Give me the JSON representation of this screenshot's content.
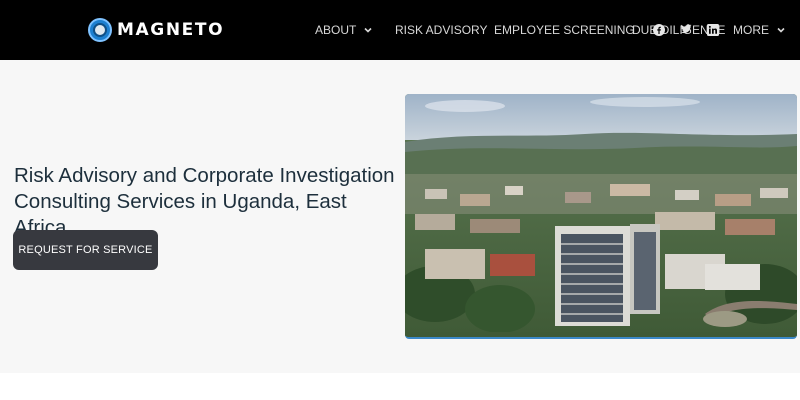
{
  "brand": {
    "name": "MAGNETO",
    "logo_icon": "globe-logo-icon"
  },
  "nav": {
    "items": [
      {
        "label": "ABOUT",
        "dropdown": true
      },
      {
        "label": "RISK ADVISORY",
        "dropdown": false
      },
      {
        "label": "EMPLOYEE SCREENING",
        "dropdown": false
      },
      {
        "label": "DUE DILIGENCE",
        "dropdown": false
      },
      {
        "label": "MORE",
        "dropdown": true
      }
    ],
    "social_icons": [
      "facebook-icon",
      "twitter-icon",
      "linkedin-icon"
    ]
  },
  "hero": {
    "title_line1": "Risk Advisory and Corporate Investigation",
    "title_line2": "Consulting Services in Uganda, East Africa.",
    "cta_label": "REQUEST FOR SERVICE"
  },
  "colors": {
    "navbar_bg": "#000000",
    "hero_bg": "#f7f7f7",
    "title_text": "#1d2f3c",
    "cta_bg": "#37393f",
    "photo_accent": "#3b89c9"
  }
}
